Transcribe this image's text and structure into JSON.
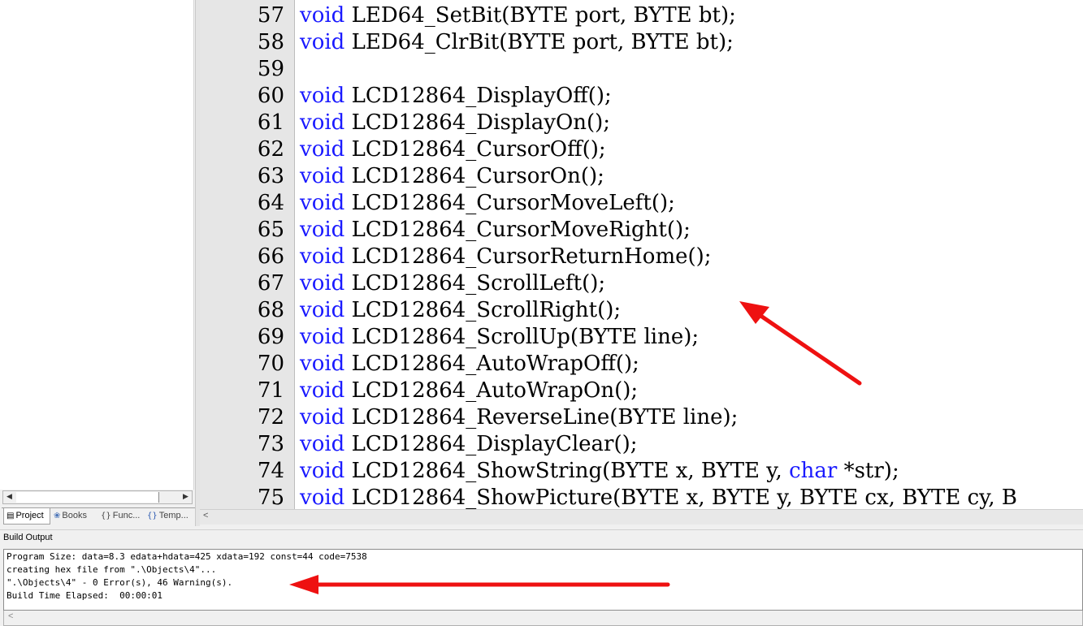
{
  "editor": {
    "lines": [
      {
        "n": "57",
        "parts": [
          {
            "t": "void",
            "kw": true
          },
          {
            "t": " LED64_SetBit(BYTE port, BYTE bt);"
          }
        ]
      },
      {
        "n": "58",
        "parts": [
          {
            "t": "void",
            "kw": true
          },
          {
            "t": " LED64_ClrBit(BYTE port, BYTE bt);"
          }
        ]
      },
      {
        "n": "59",
        "parts": []
      },
      {
        "n": "60",
        "parts": [
          {
            "t": "void",
            "kw": true
          },
          {
            "t": " LCD12864_DisplayOff();"
          }
        ]
      },
      {
        "n": "61",
        "parts": [
          {
            "t": "void",
            "kw": true
          },
          {
            "t": " LCD12864_DisplayOn();"
          }
        ]
      },
      {
        "n": "62",
        "parts": [
          {
            "t": "void",
            "kw": true
          },
          {
            "t": " LCD12864_CursorOff();"
          }
        ]
      },
      {
        "n": "63",
        "parts": [
          {
            "t": "void",
            "kw": true
          },
          {
            "t": " LCD12864_CursorOn();"
          }
        ]
      },
      {
        "n": "64",
        "parts": [
          {
            "t": "void",
            "kw": true
          },
          {
            "t": " LCD12864_CursorMoveLeft();"
          }
        ]
      },
      {
        "n": "65",
        "parts": [
          {
            "t": "void",
            "kw": true
          },
          {
            "t": " LCD12864_CursorMoveRight();"
          }
        ]
      },
      {
        "n": "66",
        "parts": [
          {
            "t": "void",
            "kw": true
          },
          {
            "t": " LCD12864_CursorReturnHome();"
          }
        ]
      },
      {
        "n": "67",
        "parts": [
          {
            "t": "void",
            "kw": true
          },
          {
            "t": " LCD12864_ScrollLeft();"
          }
        ]
      },
      {
        "n": "68",
        "parts": [
          {
            "t": "void",
            "kw": true
          },
          {
            "t": " LCD12864_ScrollRight();"
          }
        ]
      },
      {
        "n": "69",
        "parts": [
          {
            "t": "void",
            "kw": true
          },
          {
            "t": " LCD12864_ScrollUp(BYTE line);"
          }
        ]
      },
      {
        "n": "70",
        "parts": [
          {
            "t": "void",
            "kw": true
          },
          {
            "t": " LCD12864_AutoWrapOff();"
          }
        ]
      },
      {
        "n": "71",
        "parts": [
          {
            "t": "void",
            "kw": true
          },
          {
            "t": " LCD12864_AutoWrapOn();"
          }
        ]
      },
      {
        "n": "72",
        "parts": [
          {
            "t": "void",
            "kw": true
          },
          {
            "t": " LCD12864_ReverseLine(BYTE line);"
          }
        ]
      },
      {
        "n": "73",
        "parts": [
          {
            "t": "void",
            "kw": true
          },
          {
            "t": " LCD12864_DisplayClear();"
          }
        ]
      },
      {
        "n": "74",
        "parts": [
          {
            "t": "void",
            "kw": true
          },
          {
            "t": " LCD12864_ShowString(BYTE x, BYTE y, "
          },
          {
            "t": "char",
            "kw": true
          },
          {
            "t": " *str);"
          }
        ]
      },
      {
        "n": "75",
        "parts": [
          {
            "t": "void",
            "kw": true
          },
          {
            "t": " LCD12864_ShowPicture(BYTE x, BYTE y, BYTE cx, BYTE cy, B"
          }
        ]
      }
    ]
  },
  "project_tabs": [
    {
      "label": "Project",
      "icon": "project-icon",
      "active": true
    },
    {
      "label": "Books",
      "icon": "books-icon",
      "active": false
    },
    {
      "label": "Func...",
      "icon": "functions-icon",
      "active": false
    },
    {
      "label": "Temp...",
      "icon": "templates-icon",
      "active": false
    }
  ],
  "build": {
    "title": "Build Output",
    "lines": [
      "Program Size: data=8.3 edata+hdata=425 xdata=192 const=44 code=7538",
      "creating hex file from \".\\Objects\\4\"...",
      "\".\\Objects\\4\" - 0 Error(s), 46 Warning(s).",
      "Build Time Elapsed:  00:00:01"
    ]
  },
  "colors": {
    "keyword": "#1a1aff",
    "arrow": "#ee1111"
  }
}
